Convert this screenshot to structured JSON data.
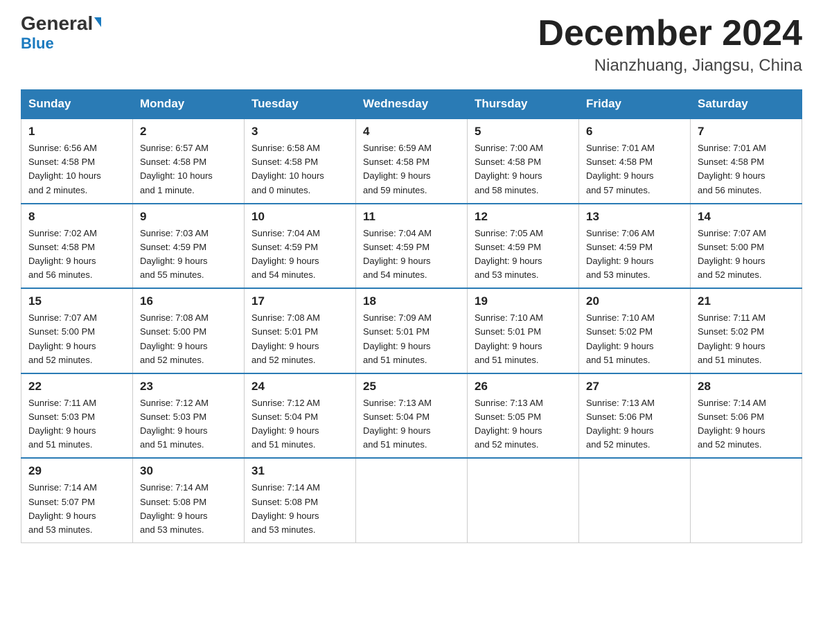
{
  "logo": {
    "line1a": "General",
    "line1b": "Blue"
  },
  "header": {
    "month": "December 2024",
    "location": "Nianzhuang, Jiangsu, China"
  },
  "days_of_week": [
    "Sunday",
    "Monday",
    "Tuesday",
    "Wednesday",
    "Thursday",
    "Friday",
    "Saturday"
  ],
  "weeks": [
    [
      {
        "day": "1",
        "sunrise": "6:56 AM",
        "sunset": "4:58 PM",
        "daylight": "10 hours and 2 minutes."
      },
      {
        "day": "2",
        "sunrise": "6:57 AM",
        "sunset": "4:58 PM",
        "daylight": "10 hours and 1 minute."
      },
      {
        "day": "3",
        "sunrise": "6:58 AM",
        "sunset": "4:58 PM",
        "daylight": "10 hours and 0 minutes."
      },
      {
        "day": "4",
        "sunrise": "6:59 AM",
        "sunset": "4:58 PM",
        "daylight": "9 hours and 59 minutes."
      },
      {
        "day": "5",
        "sunrise": "7:00 AM",
        "sunset": "4:58 PM",
        "daylight": "9 hours and 58 minutes."
      },
      {
        "day": "6",
        "sunrise": "7:01 AM",
        "sunset": "4:58 PM",
        "daylight": "9 hours and 57 minutes."
      },
      {
        "day": "7",
        "sunrise": "7:01 AM",
        "sunset": "4:58 PM",
        "daylight": "9 hours and 56 minutes."
      }
    ],
    [
      {
        "day": "8",
        "sunrise": "7:02 AM",
        "sunset": "4:58 PM",
        "daylight": "9 hours and 56 minutes."
      },
      {
        "day": "9",
        "sunrise": "7:03 AM",
        "sunset": "4:59 PM",
        "daylight": "9 hours and 55 minutes."
      },
      {
        "day": "10",
        "sunrise": "7:04 AM",
        "sunset": "4:59 PM",
        "daylight": "9 hours and 54 minutes."
      },
      {
        "day": "11",
        "sunrise": "7:04 AM",
        "sunset": "4:59 PM",
        "daylight": "9 hours and 54 minutes."
      },
      {
        "day": "12",
        "sunrise": "7:05 AM",
        "sunset": "4:59 PM",
        "daylight": "9 hours and 53 minutes."
      },
      {
        "day": "13",
        "sunrise": "7:06 AM",
        "sunset": "4:59 PM",
        "daylight": "9 hours and 53 minutes."
      },
      {
        "day": "14",
        "sunrise": "7:07 AM",
        "sunset": "5:00 PM",
        "daylight": "9 hours and 52 minutes."
      }
    ],
    [
      {
        "day": "15",
        "sunrise": "7:07 AM",
        "sunset": "5:00 PM",
        "daylight": "9 hours and 52 minutes."
      },
      {
        "day": "16",
        "sunrise": "7:08 AM",
        "sunset": "5:00 PM",
        "daylight": "9 hours and 52 minutes."
      },
      {
        "day": "17",
        "sunrise": "7:08 AM",
        "sunset": "5:01 PM",
        "daylight": "9 hours and 52 minutes."
      },
      {
        "day": "18",
        "sunrise": "7:09 AM",
        "sunset": "5:01 PM",
        "daylight": "9 hours and 51 minutes."
      },
      {
        "day": "19",
        "sunrise": "7:10 AM",
        "sunset": "5:01 PM",
        "daylight": "9 hours and 51 minutes."
      },
      {
        "day": "20",
        "sunrise": "7:10 AM",
        "sunset": "5:02 PM",
        "daylight": "9 hours and 51 minutes."
      },
      {
        "day": "21",
        "sunrise": "7:11 AM",
        "sunset": "5:02 PM",
        "daylight": "9 hours and 51 minutes."
      }
    ],
    [
      {
        "day": "22",
        "sunrise": "7:11 AM",
        "sunset": "5:03 PM",
        "daylight": "9 hours and 51 minutes."
      },
      {
        "day": "23",
        "sunrise": "7:12 AM",
        "sunset": "5:03 PM",
        "daylight": "9 hours and 51 minutes."
      },
      {
        "day": "24",
        "sunrise": "7:12 AM",
        "sunset": "5:04 PM",
        "daylight": "9 hours and 51 minutes."
      },
      {
        "day": "25",
        "sunrise": "7:13 AM",
        "sunset": "5:04 PM",
        "daylight": "9 hours and 51 minutes."
      },
      {
        "day": "26",
        "sunrise": "7:13 AM",
        "sunset": "5:05 PM",
        "daylight": "9 hours and 52 minutes."
      },
      {
        "day": "27",
        "sunrise": "7:13 AM",
        "sunset": "5:06 PM",
        "daylight": "9 hours and 52 minutes."
      },
      {
        "day": "28",
        "sunrise": "7:14 AM",
        "sunset": "5:06 PM",
        "daylight": "9 hours and 52 minutes."
      }
    ],
    [
      {
        "day": "29",
        "sunrise": "7:14 AM",
        "sunset": "5:07 PM",
        "daylight": "9 hours and 53 minutes."
      },
      {
        "day": "30",
        "sunrise": "7:14 AM",
        "sunset": "5:08 PM",
        "daylight": "9 hours and 53 minutes."
      },
      {
        "day": "31",
        "sunrise": "7:14 AM",
        "sunset": "5:08 PM",
        "daylight": "9 hours and 53 minutes."
      },
      null,
      null,
      null,
      null
    ]
  ],
  "labels": {
    "sunrise": "Sunrise:",
    "sunset": "Sunset:",
    "daylight": "Daylight:"
  }
}
